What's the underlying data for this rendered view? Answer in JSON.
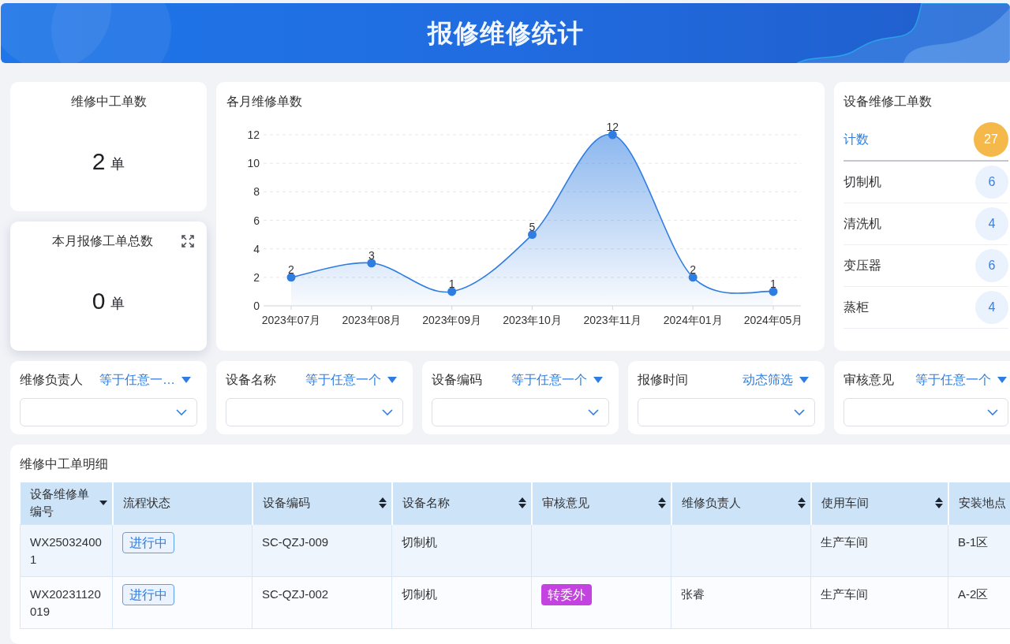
{
  "header": {
    "title": "报修维修统计"
  },
  "stat_cards": [
    {
      "title": "维修中工单数",
      "value": "2",
      "unit": "单",
      "hovered": false
    },
    {
      "title": "本月报修工单总数",
      "value": "0",
      "unit": "单",
      "hovered": true
    }
  ],
  "monthly_chart": {
    "title": "各月维修单数",
    "chart_data": {
      "type": "area",
      "categories": [
        "2023年07月",
        "2023年08月",
        "2023年09月",
        "2023年10月",
        "2023年11月",
        "2024年01月",
        "2024年05月"
      ],
      "series": [
        {
          "color": "#2f7de1",
          "values": [
            2,
            3,
            1,
            5,
            12,
            2,
            1
          ]
        }
      ],
      "ylim": [
        0,
        12
      ],
      "yticks": [
        0,
        2,
        4,
        6,
        8,
        10,
        12
      ],
      "grid": true,
      "data_labels": true
    }
  },
  "equipment_counts": {
    "title": "设备维修工单数",
    "total": {
      "label": "计数",
      "count": "27"
    },
    "items": [
      {
        "name": "切制机",
        "count": "6"
      },
      {
        "name": "清洗机",
        "count": "4"
      },
      {
        "name": "变压器",
        "count": "6"
      },
      {
        "name": "蒸柜",
        "count": "4"
      }
    ]
  },
  "filters": [
    {
      "label": "维修负责人",
      "operator": "等于任意一…"
    },
    {
      "label": "设备名称",
      "operator": "等于任意一个"
    },
    {
      "label": "设备编码",
      "operator": "等于任意一个"
    },
    {
      "label": "报修时间",
      "operator": "动态筛选"
    },
    {
      "label": "审核意见",
      "operator": "等于任意一个"
    }
  ],
  "detail_table": {
    "title": "维修中工单明细",
    "columns": [
      {
        "label": "设备维修单编号",
        "kind": "text",
        "sortable": true,
        "sorted": true
      },
      {
        "label": "流程状态",
        "kind": "status-tag",
        "sortable": false
      },
      {
        "label": "设备编码",
        "kind": "text",
        "sortable": true,
        "sorted": false
      },
      {
        "label": "设备名称",
        "kind": "text",
        "sortable": true,
        "sorted": false
      },
      {
        "label": "审核意见",
        "kind": "review-tag",
        "sortable": true,
        "sorted": false
      },
      {
        "label": "维修负责人",
        "kind": "text",
        "sortable": true,
        "sorted": false
      },
      {
        "label": "使用车间",
        "kind": "text",
        "sortable": true,
        "sorted": false
      },
      {
        "label": "安装地点",
        "kind": "text"
      }
    ],
    "rows": [
      [
        "WX250324001",
        "进行中",
        "SC-QZJ-009",
        "切制机",
        null,
        null,
        "生产车间",
        "B-1区"
      ],
      [
        "WX20231120019",
        "进行中",
        "SC-QZJ-002",
        "切制机",
        "转委外",
        "张睿",
        "生产车间",
        "A-2区"
      ]
    ]
  }
}
